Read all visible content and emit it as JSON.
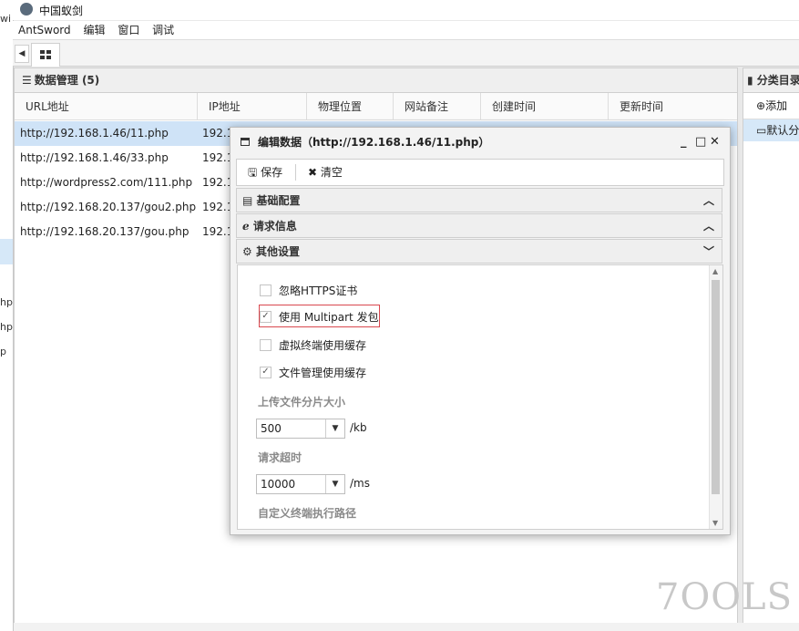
{
  "window": {
    "title": "中国蚁剑"
  },
  "menubar": {
    "items": [
      "AntSword",
      "编辑",
      "窗口",
      "调试"
    ]
  },
  "left_strip": {
    "texts": [
      "wi",
      "hp",
      "hp",
      "p"
    ]
  },
  "data_panel": {
    "title": "数据管理 (5)",
    "columns": [
      "URL地址",
      "IP地址",
      "物理位置",
      "网站备注",
      "创建时间",
      "更新时间"
    ],
    "rows": [
      {
        "url": "http://192.168.1.46/11.php",
        "ip": "192.1"
      },
      {
        "url": "http://192.168.1.46/33.php",
        "ip": "192.1"
      },
      {
        "url": "http://wordpress2.com/111.php",
        "ip": "192.1"
      },
      {
        "url": "http://192.168.20.137/gou2.php",
        "ip": "192.1"
      },
      {
        "url": "http://192.168.20.137/gou.php",
        "ip": "192.1"
      }
    ]
  },
  "category_panel": {
    "title": "分类目录",
    "add_label": "添加",
    "default_label": "默认分类"
  },
  "dialog": {
    "title": "编辑数据（http://192.168.1.46/11.php）",
    "controls": [
      "_",
      "□",
      "✕"
    ],
    "toolbar": {
      "save": "保存",
      "clear": "清空"
    },
    "sections": [
      {
        "label": "基础配置",
        "chevron": "up"
      },
      {
        "label": "请求信息",
        "chevron": "up"
      },
      {
        "label": "其他设置",
        "chevron": "down"
      }
    ],
    "options": [
      {
        "label": "忽略HTTPS证书",
        "checked": false
      },
      {
        "label": "使用 Multipart 发包",
        "checked": true
      },
      {
        "label": "虚拟终端使用缓存",
        "checked": false
      },
      {
        "label": "文件管理使用缓存",
        "checked": true
      }
    ],
    "upload_chunk": {
      "label": "上传文件分片大小",
      "value": "500",
      "unit": "/kb"
    },
    "timeout": {
      "label": "请求超时",
      "value": "10000",
      "unit": "/ms"
    },
    "custom_path": {
      "label": "自定义终端执行路径"
    }
  },
  "watermark": {
    "text": "7OOLS"
  },
  "colors": {
    "selected_row": "#cfe3f7",
    "highlight_border": "#d9484f",
    "panel_header": "#efefef"
  }
}
